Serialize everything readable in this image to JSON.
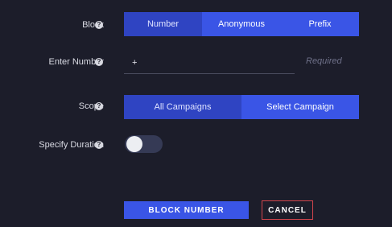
{
  "block": {
    "label": "Block",
    "options": [
      "Number",
      "Anonymous",
      "Prefix"
    ],
    "selected": "Number"
  },
  "number": {
    "label": "Enter Number",
    "value": "+",
    "hint": "Required"
  },
  "scope": {
    "label": "Scope",
    "options": [
      "All Campaigns",
      "Select Campaign"
    ],
    "selected": "All Campaigns"
  },
  "duration": {
    "label": "Specify Duration",
    "enabled": false
  },
  "help_icon": "?",
  "actions": {
    "submit_label": "BLOCK NUMBER",
    "cancel_label": "CANCEL"
  },
  "colors": {
    "background": "#1c1d2a",
    "accent": "#3a55e6",
    "accent_active": "#2f44c2",
    "cancel_border": "#d3454d"
  }
}
